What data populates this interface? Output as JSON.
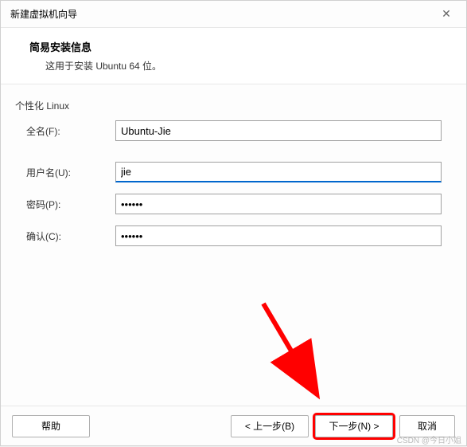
{
  "titlebar": {
    "title": "新建虚拟机向导"
  },
  "header": {
    "title": "简易安装信息",
    "subtitle": "这用于安装 Ubuntu 64 位。"
  },
  "section": {
    "label": "个性化 Linux"
  },
  "form": {
    "fullname_label": "全名(F):",
    "fullname_value": "Ubuntu-Jie",
    "username_label": "用户名(U):",
    "username_value": "jie",
    "password_label": "密码(P):",
    "password_value": "••••••",
    "confirm_label": "确认(C):",
    "confirm_value": "••••••"
  },
  "footer": {
    "help": "帮助",
    "back": "< 上一步(B)",
    "next": "下一步(N) >",
    "cancel": "取消"
  },
  "watermark": "CSDN @今日小姐"
}
